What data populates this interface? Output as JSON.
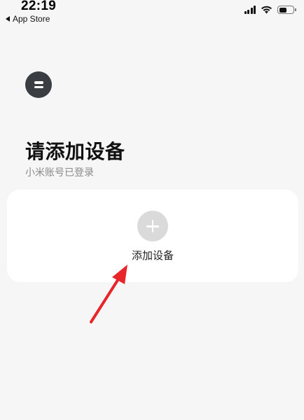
{
  "status_bar": {
    "time": "22:19",
    "back_app": "App Store",
    "wifi_icon": "wifi-icon",
    "signal_icon": "cellular-signal-icon",
    "battery_icon": "battery-icon",
    "battery_level": 0.55
  },
  "header": {
    "menu_icon": "menu-icon",
    "title": "请添加设备",
    "subtitle": "小米账号已登录"
  },
  "add_device_card": {
    "icon": "plus-icon",
    "label": "添加设备"
  },
  "annotation": {
    "icon": "red-arrow-icon",
    "color": "#e8262a"
  }
}
